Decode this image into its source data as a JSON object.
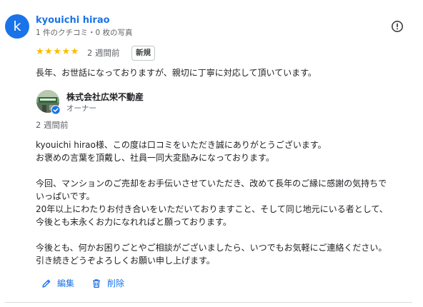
{
  "reviewer": {
    "initial": "k",
    "name": "kyouichi hirao",
    "meta": "1 件のクチコミ・0 枚の写真",
    "rating_stars": "★★★★★",
    "rating": 5,
    "date": "2 週間前",
    "new_badge": "新規",
    "text": "長年、お世話になっておりますが、親切に丁寧に対応して頂いています。"
  },
  "owner_reply": {
    "name": "株式会社広栄不動産",
    "role": "オーナー",
    "date": "2 週間前",
    "lines": [
      "kyouichi hirao様、この度は口コミをいただき誠にありがとうございます。",
      "お褒めの言葉を頂戴し、社員一同大変励みになっております。",
      "今回、マンションのご売却をお手伝いさせていただき、改めて長年のご縁に感謝の気持ちで",
      "いっぱいです。",
      "20年以上にわたりお付き合いをいただいておりますこと、そして同じ地元にいる者として、",
      "今後とも末永くお力になれればと願っております。",
      "今後とも、何かお困りごとやご相談がございましたら、いつでもお気軽にご連絡ください。",
      "引き続きどうぞよろしくお願い申し上げます。"
    ]
  },
  "actions": {
    "edit_label": "編集",
    "delete_label": "削除"
  },
  "colors": {
    "accent": "#1a73e8",
    "star": "#fbbc04",
    "muted": "#5f6368"
  },
  "icons": [
    "more-options-icon",
    "verified-badge-icon",
    "edit-pencil-icon",
    "trash-icon"
  ]
}
